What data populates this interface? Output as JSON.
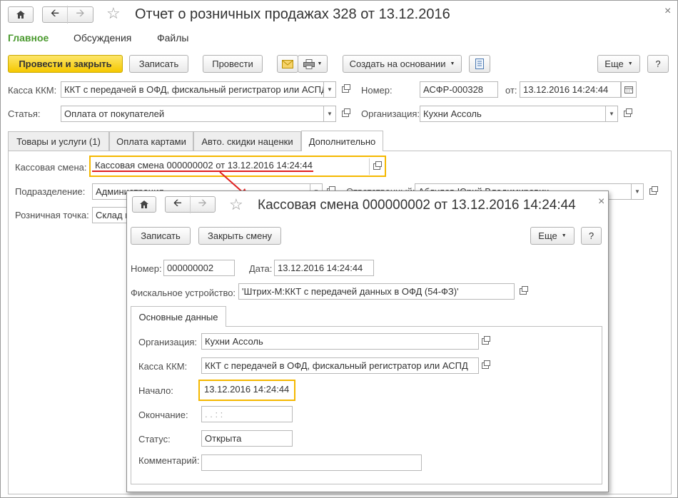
{
  "main": {
    "title": "Отчет о розничных продажах 328 от 13.12.2016",
    "menu": [
      "Главное",
      "Обсуждения",
      "Файлы"
    ],
    "toolbar": {
      "post_close": "Провести и закрыть",
      "save": "Записать",
      "post": "Провести",
      "create_based": "Создать на основании",
      "more": "Еще",
      "help": "?"
    },
    "fields": {
      "kassa_label": "Касса ККМ:",
      "kassa_value": "ККТ с передачей в ОФД, фискальный регистратор или АСПД",
      "number_label": "Номер:",
      "number_value": "АСФР-000328",
      "date_label": "от:",
      "date_value": "13.12.2016 14:24:44",
      "article_label": "Статья:",
      "article_value": "Оплата от покупателей",
      "org_label": "Организация:",
      "org_value": "Кухни Ассоль"
    },
    "tabs": [
      "Товары и услуги (1)",
      "Оплата картами",
      "Авто. скидки наценки",
      "Дополнительно"
    ],
    "extra": {
      "shift_label": "Кассовая смена:",
      "shift_value": "Кассовая смена 000000002 от 13.12.2016 14:24:44",
      "division_label": "Подразделение:",
      "division_value": "Администрация",
      "responsible_label": "Ответственный:",
      "responsible_value": "Абдулов Юрий Владимирович",
      "retail_label": "Розничная точка:",
      "retail_value": "Склад м"
    }
  },
  "popup": {
    "title": "Кассовая смена 000000002 от 13.12.2016 14:24:44",
    "toolbar": {
      "save": "Записать",
      "close_shift": "Закрыть смену",
      "more": "Еще",
      "help": "?"
    },
    "fields": {
      "number_label": "Номер:",
      "number_value": "000000002",
      "date_label": "Дата:",
      "date_value": "13.12.2016 14:24:44",
      "fiscal_label": "Фискальное устройство:",
      "fiscal_value": "'Штрих-М:ККТ с передачей данных в ОФД (54-ФЗ)'"
    },
    "tab": "Основные данные",
    "details": {
      "org_label": "Организация:",
      "org_value": "Кухни Ассоль",
      "kassa_label": "Касса ККМ:",
      "kassa_value": "ККТ с передачей в ОФД, фискальный регистратор или АСПД",
      "start_label": "Начало:",
      "start_value": "13.12.2016 14:24:44",
      "end_label": "Окончание:",
      "end_value": " .  .       :  :",
      "status_label": "Статус:",
      "status_value": "Открыта",
      "comment_label": "Комментарий:",
      "comment_value": ""
    }
  },
  "colors": {
    "accent_green": "#4b9a2f",
    "highlight": "#f5b800",
    "arrow_red": "#e02020",
    "primary_button": "#f5c800"
  }
}
